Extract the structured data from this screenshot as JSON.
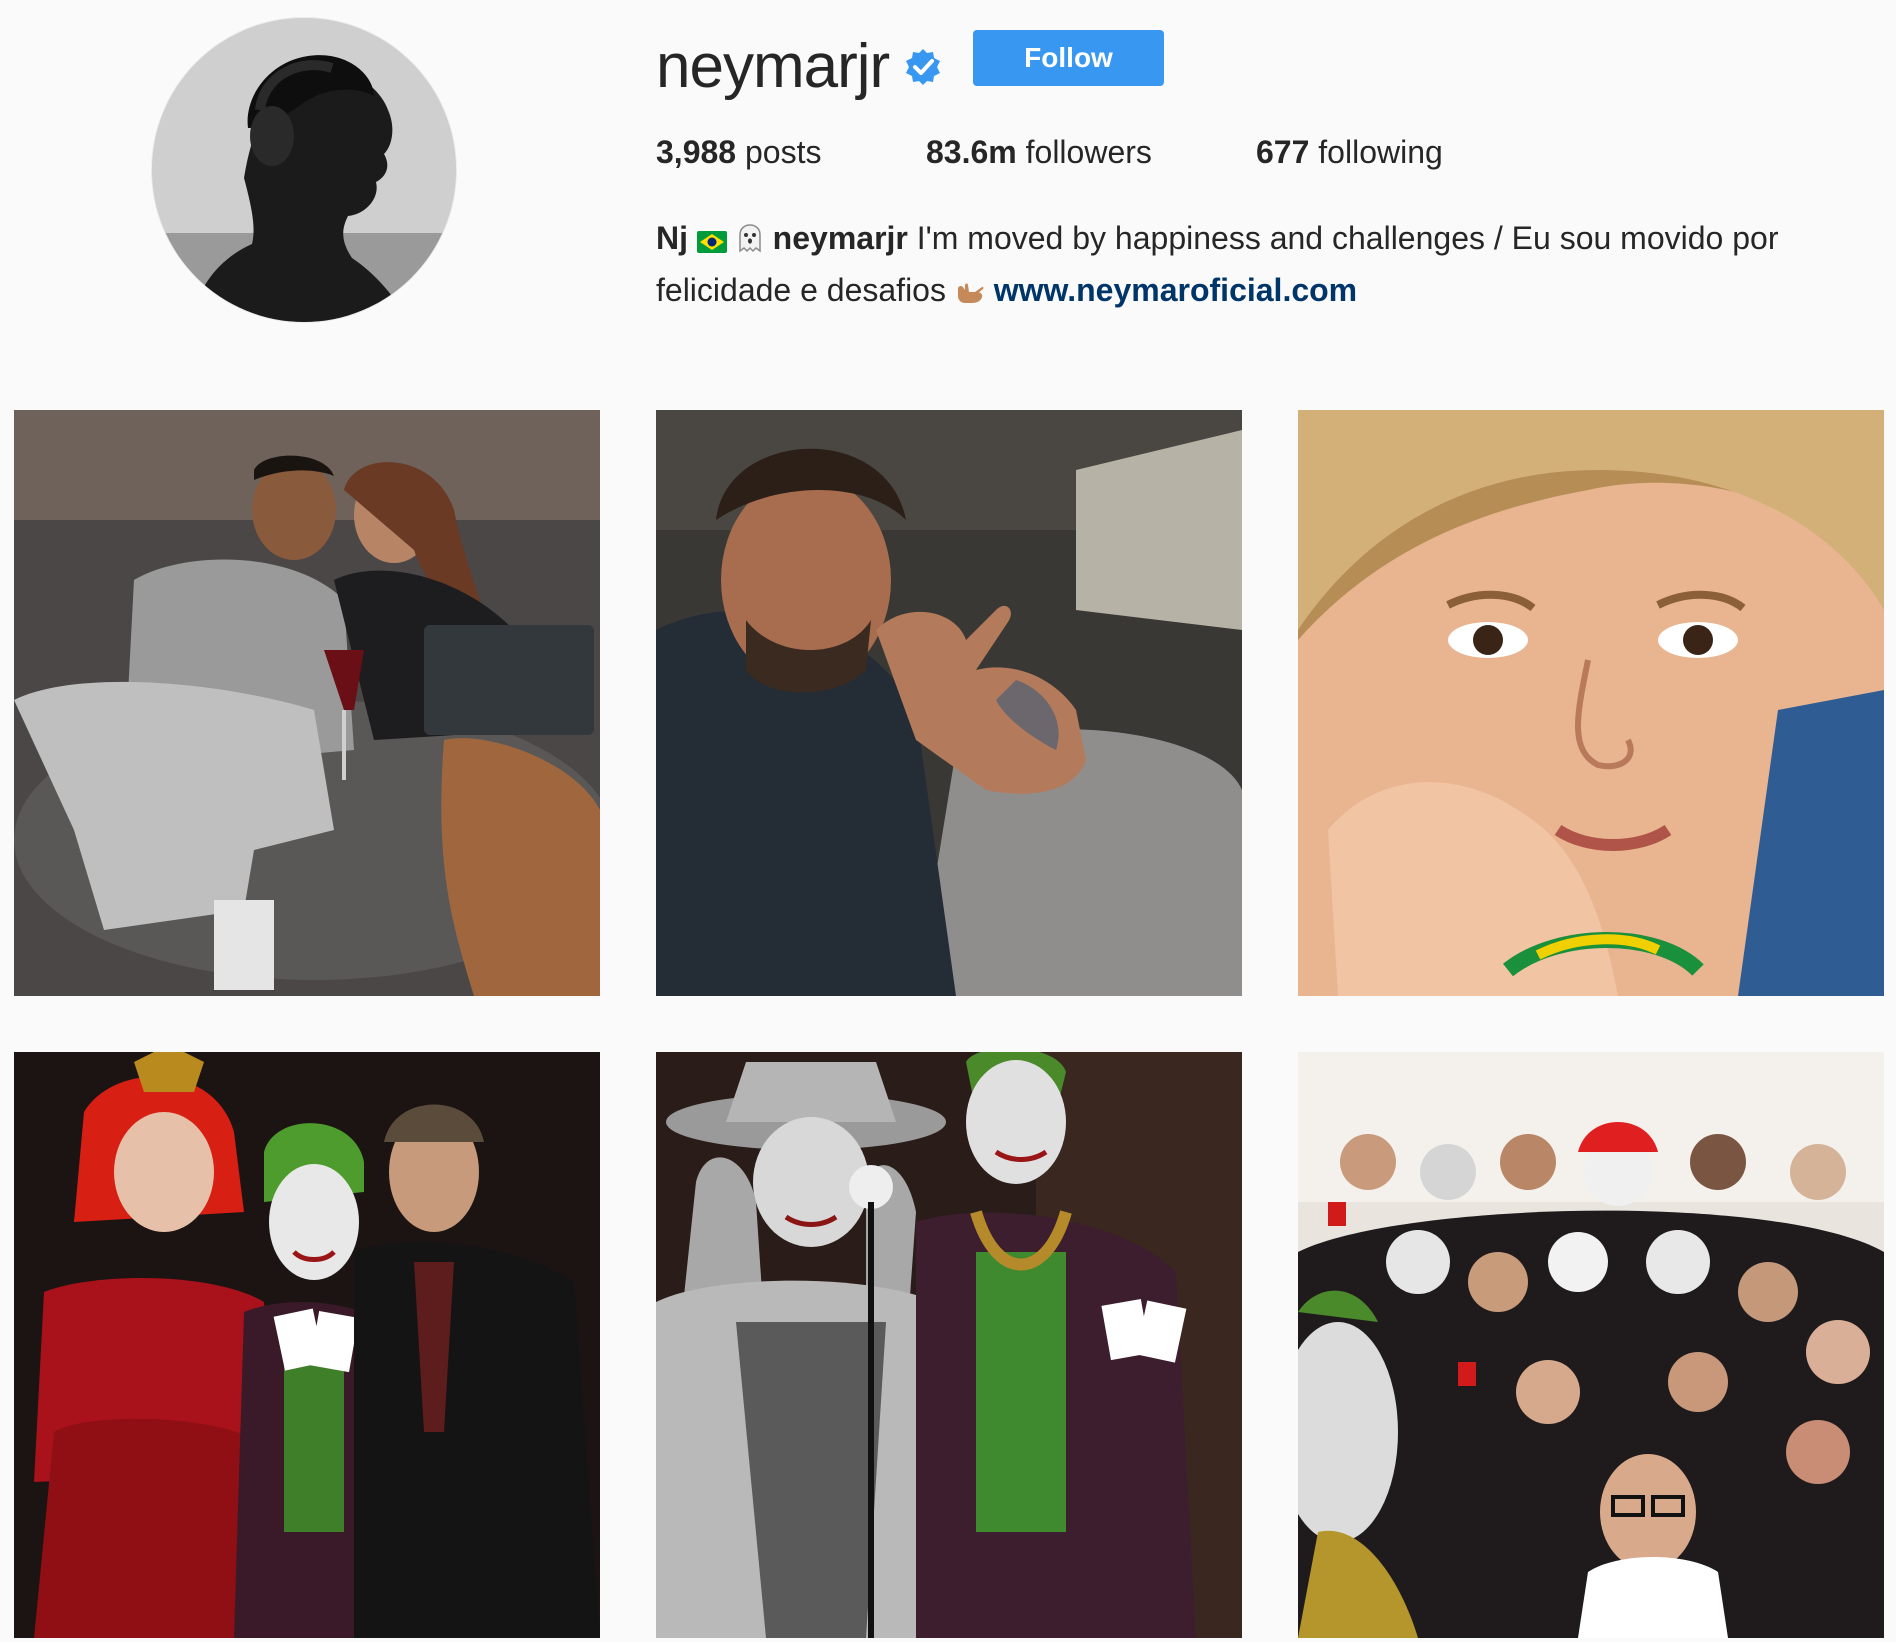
{
  "profile": {
    "username": "neymarjr",
    "verified": true,
    "follow_label": "Follow",
    "avatar_icon": "profile-photo"
  },
  "stats": {
    "posts_count": "3,988",
    "posts_label": "posts",
    "followers_count": "83.6m",
    "followers_label": "followers",
    "following_count": "677",
    "following_label": "following"
  },
  "bio": {
    "name": "Nj",
    "flag_icon": "brazil-flag-icon",
    "ghost_icon": "ghost-icon",
    "handle": "neymarjr",
    "text_line1": "I'm moved by happiness and challenges / Eu sou movido por",
    "text_line2": "felicidade e desafios",
    "hand_icon": "call-me-hand-icon",
    "link": "www.neymaroficial.com"
  },
  "posts": [
    {
      "subject": "couple-on-couch-photo"
    },
    {
      "subject": "selfie-hand-gesture-photo"
    },
    {
      "subject": "child-portrait-photo"
    },
    {
      "subject": "halloween-costume-trio-photo"
    },
    {
      "subject": "halloween-joker-pair-photo"
    },
    {
      "subject": "halloween-group-selfie-photo"
    }
  ],
  "colors": {
    "background": "#fafafa",
    "text": "#262626",
    "button": "#3897f0",
    "link": "#003569",
    "verified": "#3897f0"
  }
}
